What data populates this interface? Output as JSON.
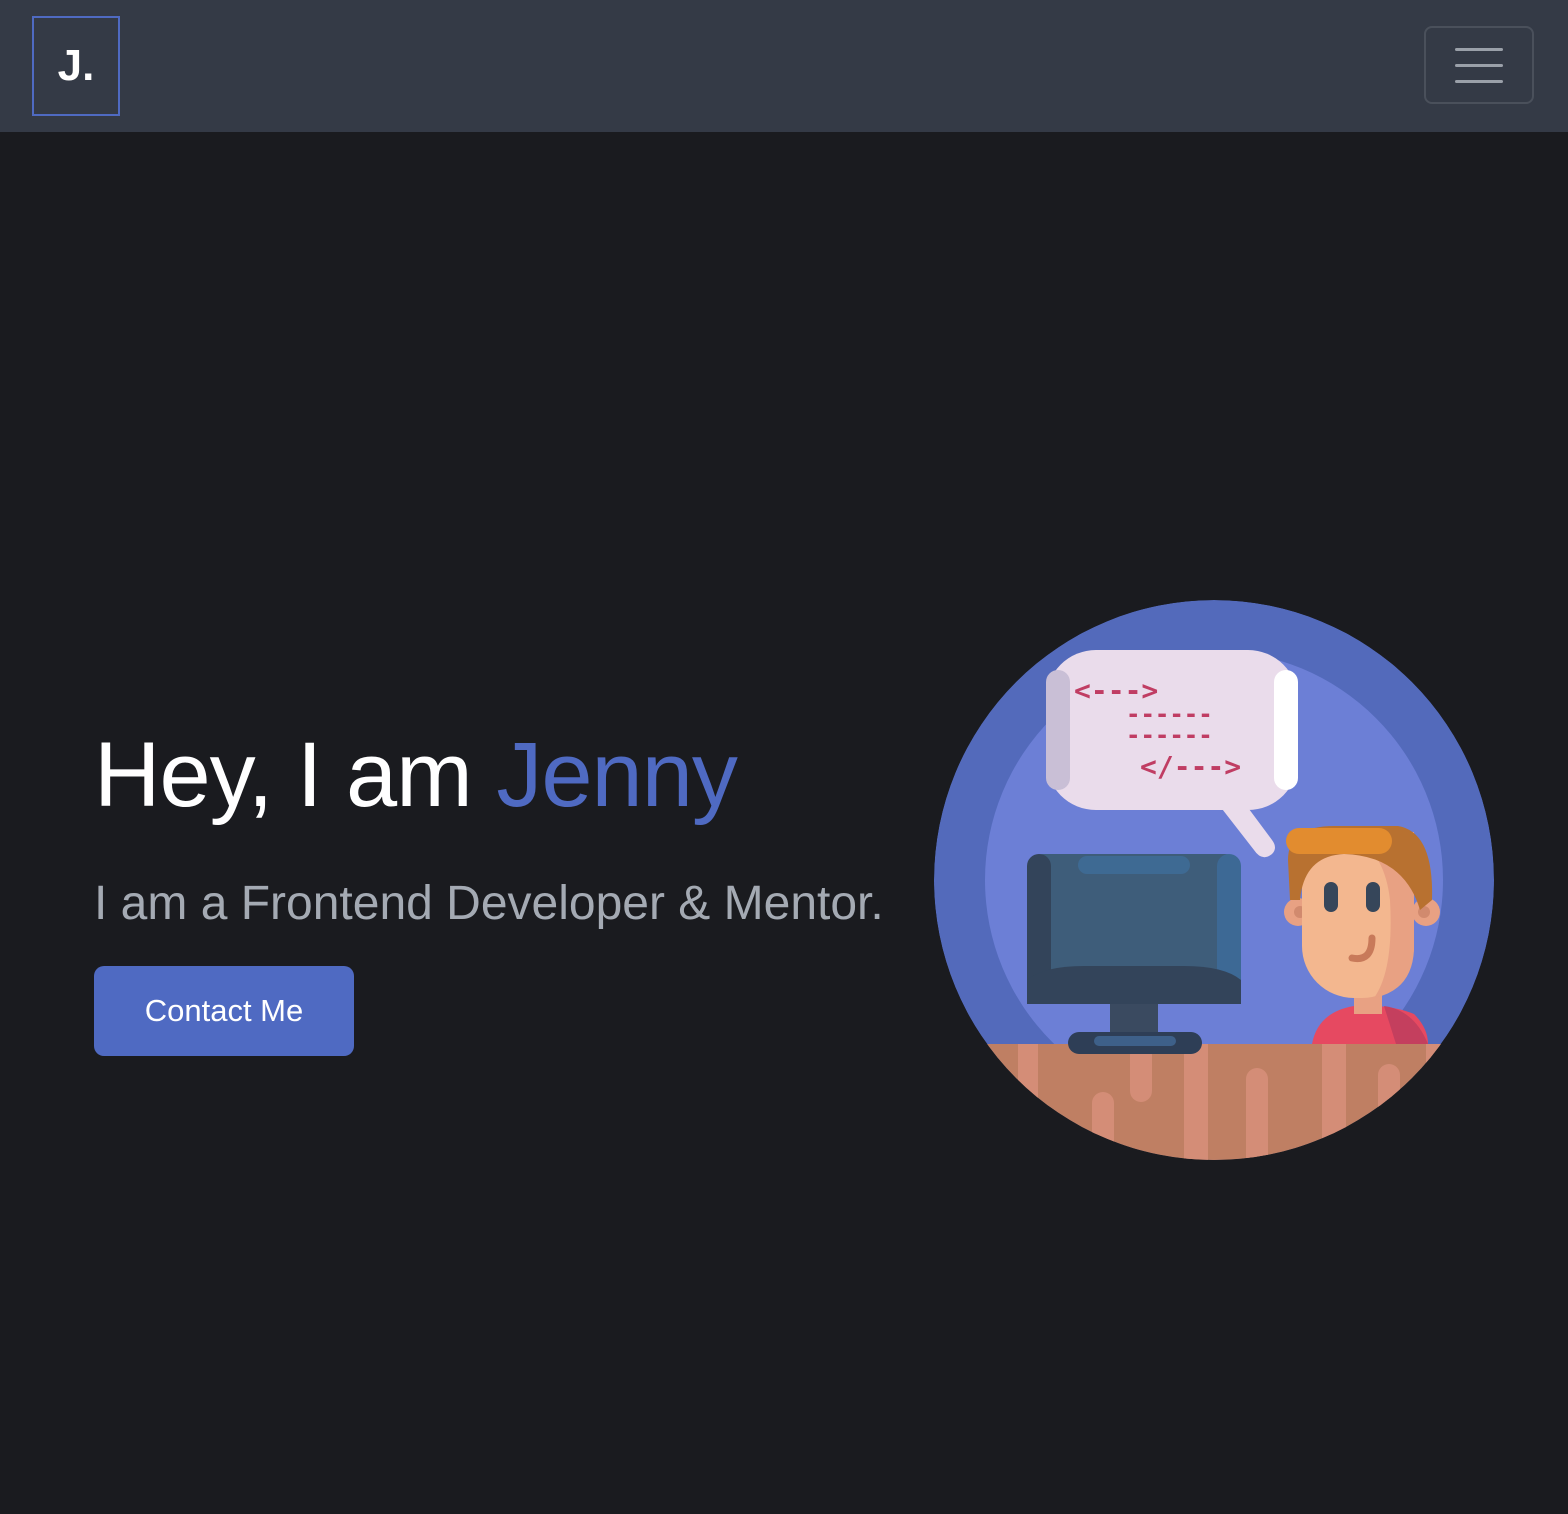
{
  "navbar": {
    "brand": "J.",
    "toggler_icon": "hamburger-menu-icon"
  },
  "hero": {
    "greeting": "Hey, I am",
    "name": "Jenny",
    "subtitle": "I am a Frontend Developer & Mentor.",
    "cta_label": "Contact Me",
    "illustration_code_lines": [
      "<--->",
      "------",
      "------",
      "</--->"
    ]
  },
  "colors": {
    "background": "#1a1b1f",
    "navbar": "#343a46",
    "accent": "#4f6ac2",
    "subtitle": "#a4aab3"
  }
}
